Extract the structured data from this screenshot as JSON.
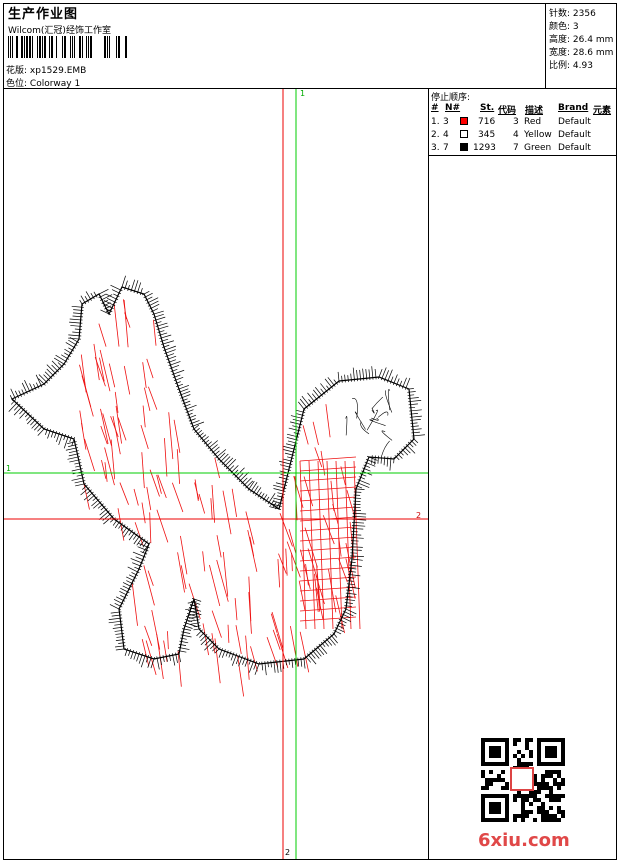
{
  "header": {
    "title": "生产作业图",
    "subtitle": "Wilcom(汇冠)经饰工作室",
    "design_label": "花版:",
    "design_value": "xp1529.EMB",
    "colorway_label": "色位:",
    "colorway_value": "Colorway 1"
  },
  "stats": [
    {
      "label": "针数:",
      "value": "2356"
    },
    {
      "label": "颜色:",
      "value": "3"
    },
    {
      "label": "高度:",
      "value": "26.4 mm"
    },
    {
      "label": "宽度:",
      "value": "28.6 mm"
    },
    {
      "label": "比例:",
      "value": "4.93"
    }
  ],
  "sequence": {
    "title": "停止顺序:",
    "headers": {
      "num": "#",
      "n": "N#",
      "st": "St.",
      "code": "代码",
      "desc": "描述",
      "brand": "Brand",
      "element": "元素"
    },
    "rows": [
      {
        "num": "1.",
        "n": "3",
        "color": "#ff0000",
        "st": "716",
        "code": "3",
        "desc": "Red",
        "brand": "Default"
      },
      {
        "num": "2.",
        "n": "4",
        "color": "#ffffff",
        "st": "345",
        "code": "4",
        "desc": "Yellow",
        "brand": "Default"
      },
      {
        "num": "3.",
        "n": "7",
        "color": "#000000",
        "st": "1293",
        "code": "7",
        "desc": "Green",
        "brand": "Default"
      }
    ]
  },
  "axes": {
    "label_1": "1",
    "label_2": "2"
  },
  "colors": {
    "guide_green": "#00cc00",
    "guide_red": "#ee0000",
    "stitch_red": "#ee1111",
    "stitch_black": "#000000"
  },
  "watermark": "6xiu.com"
}
